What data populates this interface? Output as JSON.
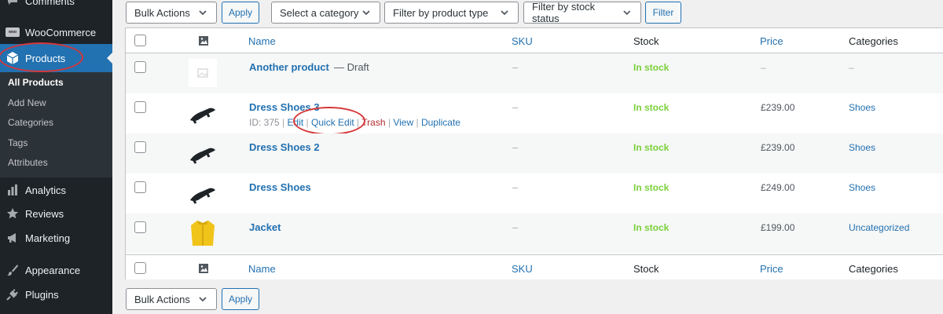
{
  "sidebar": {
    "top_partial": "Comments",
    "woocommerce": "WooCommerce",
    "woo_badge": "woo",
    "products": "Products",
    "submenu": [
      "All Products",
      "Add New",
      "Categories",
      "Tags",
      "Attributes"
    ],
    "analytics": "Analytics",
    "reviews": "Reviews",
    "marketing": "Marketing",
    "appearance": "Appearance",
    "plugins": "Plugins",
    "icons": {
      "comments": "comment-icon",
      "woocommerce": "woocommerce-icon",
      "products": "box-icon",
      "analytics": "bar-chart-icon",
      "reviews": "star-icon",
      "marketing": "megaphone-icon",
      "appearance": "paintbrush-icon",
      "plugins": "plug-icon"
    }
  },
  "toolbar_top": {
    "bulk_actions": "Bulk Actions",
    "apply": "Apply",
    "category_filter": "Select a category",
    "type_filter": "Filter by product type",
    "stock_filter": "Filter by stock status",
    "filter_button": "Filter"
  },
  "table": {
    "headers": {
      "name": "Name",
      "sku": "SKU",
      "stock": "Stock",
      "price": "Price",
      "categories": "Categories"
    },
    "rows": [
      {
        "name": "Another product",
        "state": "— Draft",
        "sku": "–",
        "stock": "In stock",
        "price": "–",
        "category": "–",
        "thumbnail": "placeholder-image"
      },
      {
        "name": "Dress Shoes 3",
        "sku": "–",
        "stock": "In stock",
        "price": "£239.00",
        "category": "Shoes",
        "thumbnail": "black-shoe",
        "actions": {
          "id": "ID: 375",
          "sep": "|",
          "edit": "Edit",
          "quick_edit": "Quick Edit",
          "trash": "Trash",
          "view": "View",
          "duplicate": "Duplicate"
        }
      },
      {
        "name": "Dress Shoes 2",
        "sku": "–",
        "stock": "In stock",
        "price": "£239.00",
        "category": "Shoes",
        "thumbnail": "black-shoe"
      },
      {
        "name": "Dress Shoes",
        "sku": "–",
        "stock": "In stock",
        "price": "£249.00",
        "category": "Shoes",
        "thumbnail": "black-shoe"
      },
      {
        "name": "Jacket",
        "sku": "–",
        "stock": "In stock",
        "price": "£199.00",
        "category": "Uncategorized",
        "thumbnail": "yellow-jacket"
      }
    ]
  },
  "toolbar_bottom": {
    "bulk_actions": "Bulk Actions",
    "apply": "Apply"
  },
  "colors": {
    "sidebar_bg": "#1d2327",
    "submenu_bg": "#2c3338",
    "accent": "#2271b1",
    "in_stock": "#7ad03a",
    "annotation": "#d63638"
  }
}
